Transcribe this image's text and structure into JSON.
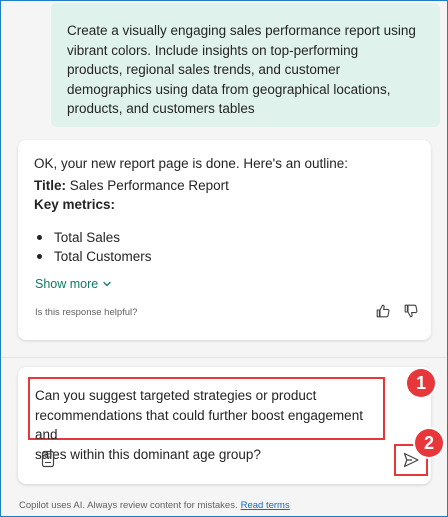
{
  "user_message": {
    "lines": [
      "Create a visually engaging sales performance report using",
      "vibrant colors. Include insights on top-performing",
      "products, regional sales trends, and customer",
      "demographics using data from geographical locations,",
      "products, and customers tables"
    ]
  },
  "ai_response": {
    "intro": "OK, your new report page is done. Here's an outline:",
    "title_label": "Title:",
    "title_value": "Sales Performance Report",
    "metrics_label": "Key metrics:",
    "bullets": [
      "Total Sales",
      "Total Customers"
    ],
    "show_more": "Show more",
    "helpful_prompt": "Is this response helpful?"
  },
  "composer": {
    "lines": [
      "Can you suggest targeted strategies or product",
      "recommendations that could further boost engagement and",
      "sales within this dominant age group?"
    ]
  },
  "callouts": [
    "1",
    "2"
  ],
  "footer": {
    "disclaimer": "Copilot uses AI. Always review content for mistakes.",
    "link": "Read terms"
  },
  "colors": {
    "accent": "#117865",
    "user_bubble": "#e0f2ec",
    "highlight": "#e8373a",
    "link": "#0f6cbd"
  },
  "icons": {
    "show_more": "chevron-down-icon",
    "like": "thumbs-up-icon",
    "dislike": "thumbs-down-icon",
    "prompt_guide": "notebook-icon",
    "send": "send-icon"
  }
}
